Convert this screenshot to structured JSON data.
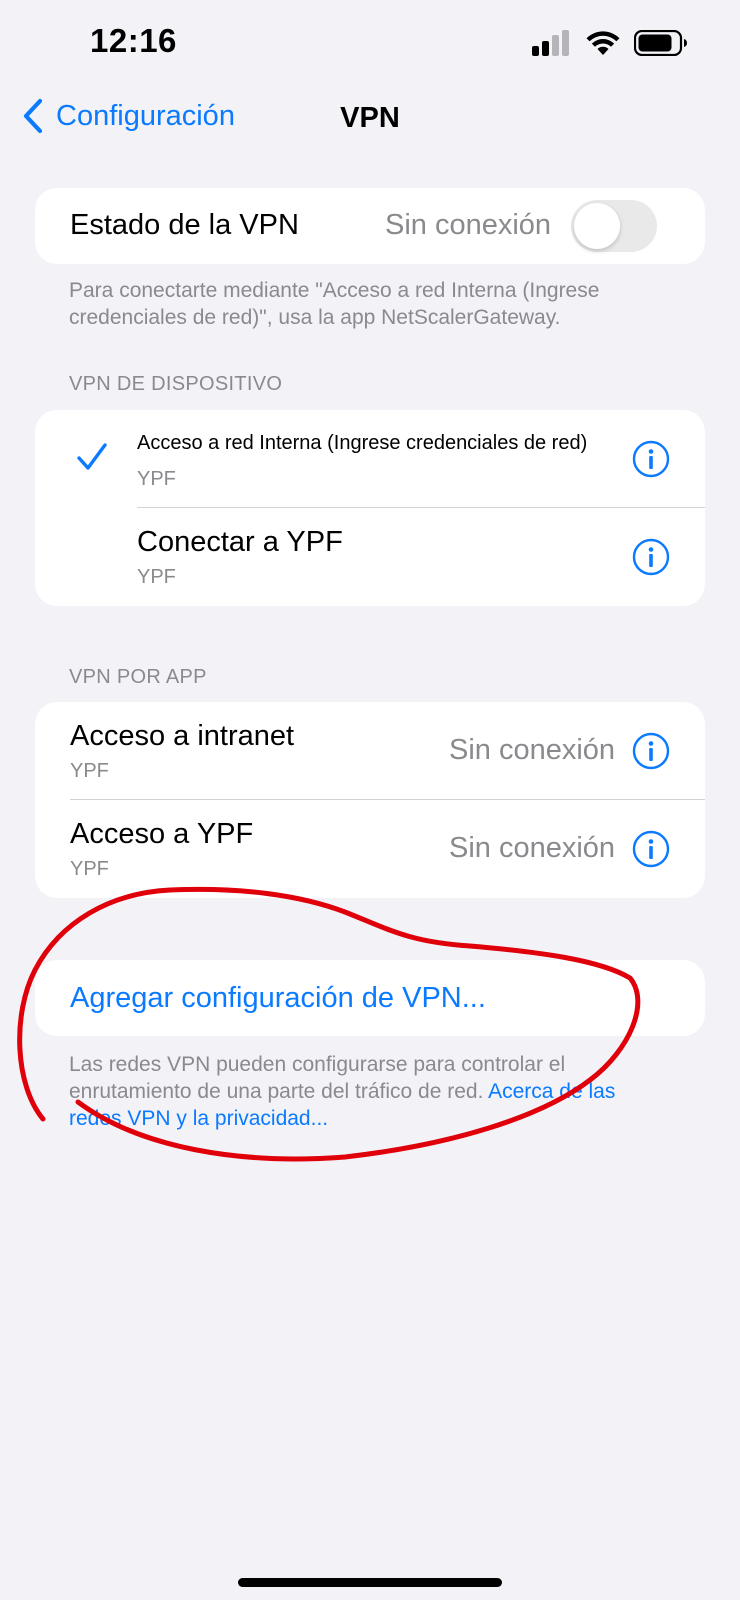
{
  "status_bar": {
    "time": "12:16"
  },
  "nav": {
    "back_label": "Configuración",
    "title": "VPN"
  },
  "vpn_status": {
    "label": "Estado de la VPN",
    "value": "Sin conexión",
    "toggle_on": false
  },
  "vpn_footnote": "Para conectarte mediante \"Acceso a red Interna (Ingrese credenciales de red)\", usa la app NetScalerGateway.",
  "device_section": {
    "header": "VPN DE DISPOSITIVO",
    "items": [
      {
        "title": "Acceso a red Interna (Ingrese credenciales de red)",
        "subtitle": "YPF",
        "selected": true
      },
      {
        "title": "Conectar a YPF",
        "subtitle": "YPF",
        "selected": false
      }
    ]
  },
  "app_section": {
    "header": "VPN POR APP",
    "items": [
      {
        "title": "Acceso a intranet",
        "subtitle": "YPF",
        "status": "Sin conexión"
      },
      {
        "title": "Acceso a YPF",
        "subtitle": "YPF",
        "status": "Sin conexión"
      }
    ]
  },
  "add_config": {
    "label": "Agregar configuración de VPN..."
  },
  "bottom_footnote": {
    "text": "Las redes VPN pueden configurarse para controlar el enrutamiento de una parte del tráfico de red. ",
    "link": "Acerca de las redes VPN y la privacidad..."
  },
  "colors": {
    "accent": "#0A7AFF",
    "background": "#F2F2F7",
    "secondary_text": "#8A8A8E",
    "annotation": "#E0000A"
  },
  "icons": {
    "back": "chevron-left-icon",
    "check": "checkmark-icon",
    "info": "info-circle-icon",
    "signal": "cellular-signal-icon",
    "wifi": "wifi-icon",
    "battery": "battery-icon"
  }
}
